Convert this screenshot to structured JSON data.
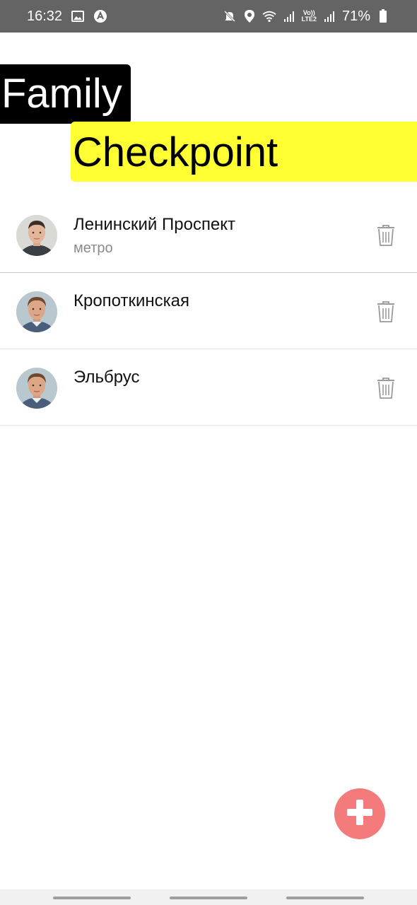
{
  "status_bar": {
    "time": "16:32",
    "battery": "71%",
    "network_label_top": "Vo))",
    "network_label_bottom": "LTE2",
    "icons": [
      "image-icon",
      "app-logo-icon",
      "mute-icon",
      "location-icon",
      "wifi-icon",
      "signal-icon",
      "battery-icon"
    ]
  },
  "header": {
    "title_line1": "Family",
    "title_line2": "Checkpoint",
    "colors": {
      "line1_bg": "#000000",
      "line1_fg": "#ffffff",
      "line2_bg": "#ffff33",
      "line2_fg": "#000000"
    }
  },
  "checkpoints": [
    {
      "title": "Ленинский Проспект",
      "subtitle": "метро"
    },
    {
      "title": "Кропоткинская",
      "subtitle": ""
    },
    {
      "title": "Эльбрус",
      "subtitle": ""
    }
  ],
  "fab": {
    "icon": "plus-icon",
    "color": "#f47b7b"
  }
}
